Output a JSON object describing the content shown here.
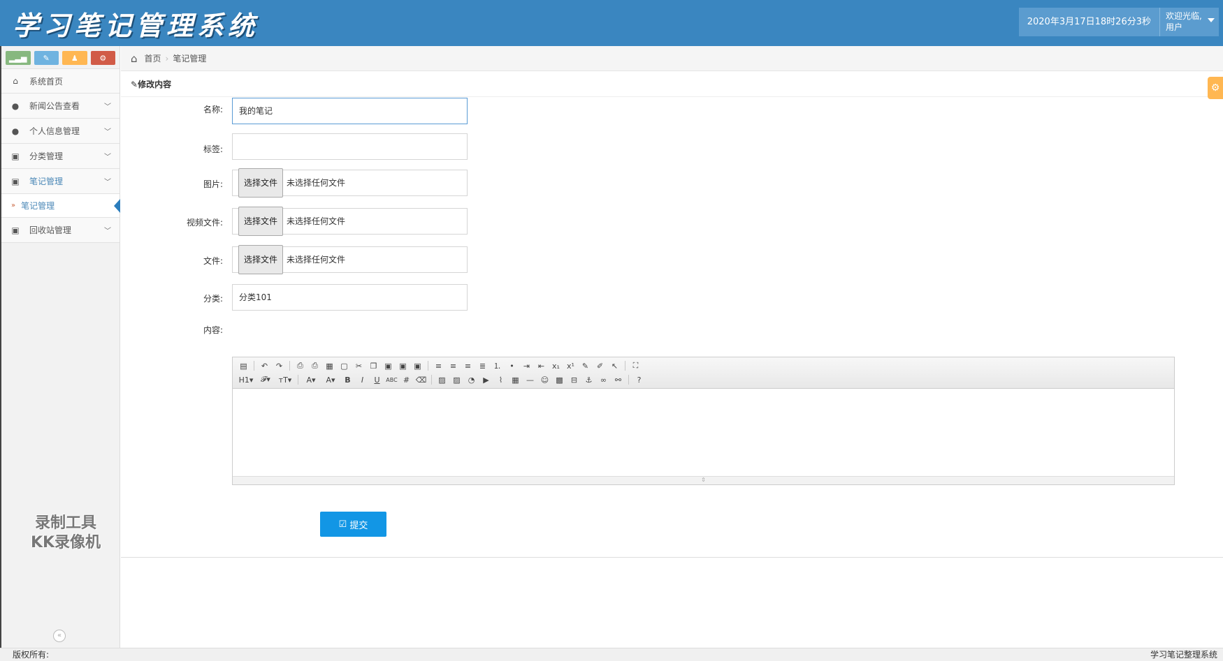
{
  "header": {
    "app_title": "学习笔记管理系统",
    "datetime": "2020年3月17日18时26分3秒",
    "welcome": "欢迎光临,",
    "user_role": "用户"
  },
  "sidebar": {
    "shortcuts": [
      {
        "icon": "bar-chart-icon"
      },
      {
        "icon": "pencil-icon"
      },
      {
        "icon": "users-icon"
      },
      {
        "icon": "cogs-icon"
      }
    ],
    "items": [
      {
        "label": "系统首页",
        "icon": "home-icon"
      },
      {
        "label": "新闻公告查看",
        "icon": "user-icon"
      },
      {
        "label": "个人信息管理",
        "icon": "user-icon"
      },
      {
        "label": "分类管理",
        "icon": "picture-icon"
      },
      {
        "label": "笔记管理",
        "icon": "picture-icon"
      },
      {
        "label": "回收站管理",
        "icon": "picture-icon"
      }
    ],
    "sub_items": [
      {
        "label": "笔记管理"
      }
    ],
    "watermark_line1": "录制工具",
    "watermark_line2": "KK录像机"
  },
  "breadcrumb": {
    "home": "首页",
    "current": "笔记管理"
  },
  "form": {
    "panel_title": "修改内容",
    "name_label": "名称:",
    "name_value": "我的笔记",
    "tag_label": "标签:",
    "tag_value": "",
    "image_label": "图片:",
    "video_label": "视频文件:",
    "file_label": "文件:",
    "choose_file_btn": "选择文件",
    "no_file_text": "未选择任何文件",
    "category_label": "分类:",
    "category_value": "分类101",
    "content_label": "内容:",
    "submit_label": "提交"
  },
  "footer": {
    "copyright": "版权所有:",
    "system_name": "学习笔记整理系统"
  },
  "colors": {
    "header_bg": "#3a86c0",
    "accent_blue": "#1296e5",
    "active_nav": "#4b88b7"
  }
}
